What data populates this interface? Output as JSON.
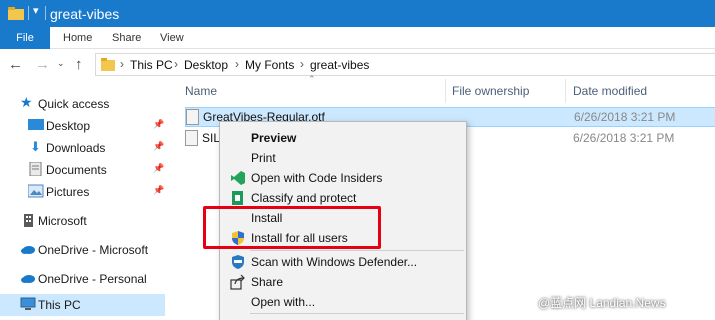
{
  "window": {
    "title": "great-vibes"
  },
  "ribbon": {
    "tabs": [
      "File",
      "Home",
      "Share",
      "View"
    ]
  },
  "address": {
    "crumbs": [
      "This PC",
      "Desktop",
      "My Fonts",
      "great-vibes"
    ]
  },
  "navpane": {
    "items": [
      {
        "label": "Quick access",
        "icon": "star-icon"
      },
      {
        "label": "Desktop",
        "icon": "desktop-icon",
        "pinned": true
      },
      {
        "label": "Downloads",
        "icon": "download-icon",
        "pinned": true
      },
      {
        "label": "Documents",
        "icon": "documents-icon",
        "pinned": true
      },
      {
        "label": "Pictures",
        "icon": "pictures-icon",
        "pinned": true
      },
      {
        "label": "Microsoft",
        "icon": "building-icon"
      },
      {
        "label": "OneDrive - Microsoft",
        "icon": "cloud-icon"
      },
      {
        "label": "OneDrive - Personal",
        "icon": "cloud-icon"
      },
      {
        "label": "This PC",
        "icon": "computer-icon",
        "selected": true
      }
    ]
  },
  "columns": {
    "name": "Name",
    "ownership": "File ownership",
    "date": "Date modified"
  },
  "files": [
    {
      "name": "GreatVibes-Regular.otf",
      "date": "6/26/2018 3:21 PM",
      "selected": true
    },
    {
      "name": "SIL",
      "date": "6/26/2018 3:21 PM",
      "selected": false
    }
  ],
  "context_menu": {
    "items": [
      {
        "label": "Preview",
        "bold": true
      },
      {
        "label": "Print"
      },
      {
        "label": "Open with Code Insiders",
        "icon": "vscode-icon"
      },
      {
        "label": "Classify and protect",
        "icon": "classify-icon"
      },
      {
        "label": "Install"
      },
      {
        "label": "Install for all users",
        "icon": "uac-shield-icon"
      },
      {
        "label": "Scan with Windows Defender...",
        "icon": "defender-icon"
      },
      {
        "label": "Share",
        "icon": "share-icon"
      },
      {
        "label": "Open with..."
      }
    ]
  },
  "colors": {
    "accent": "#1979ca",
    "selection": "#cce8ff",
    "highlight_box": "#e60012"
  },
  "watermark": "@蓝点网 Landian.News"
}
